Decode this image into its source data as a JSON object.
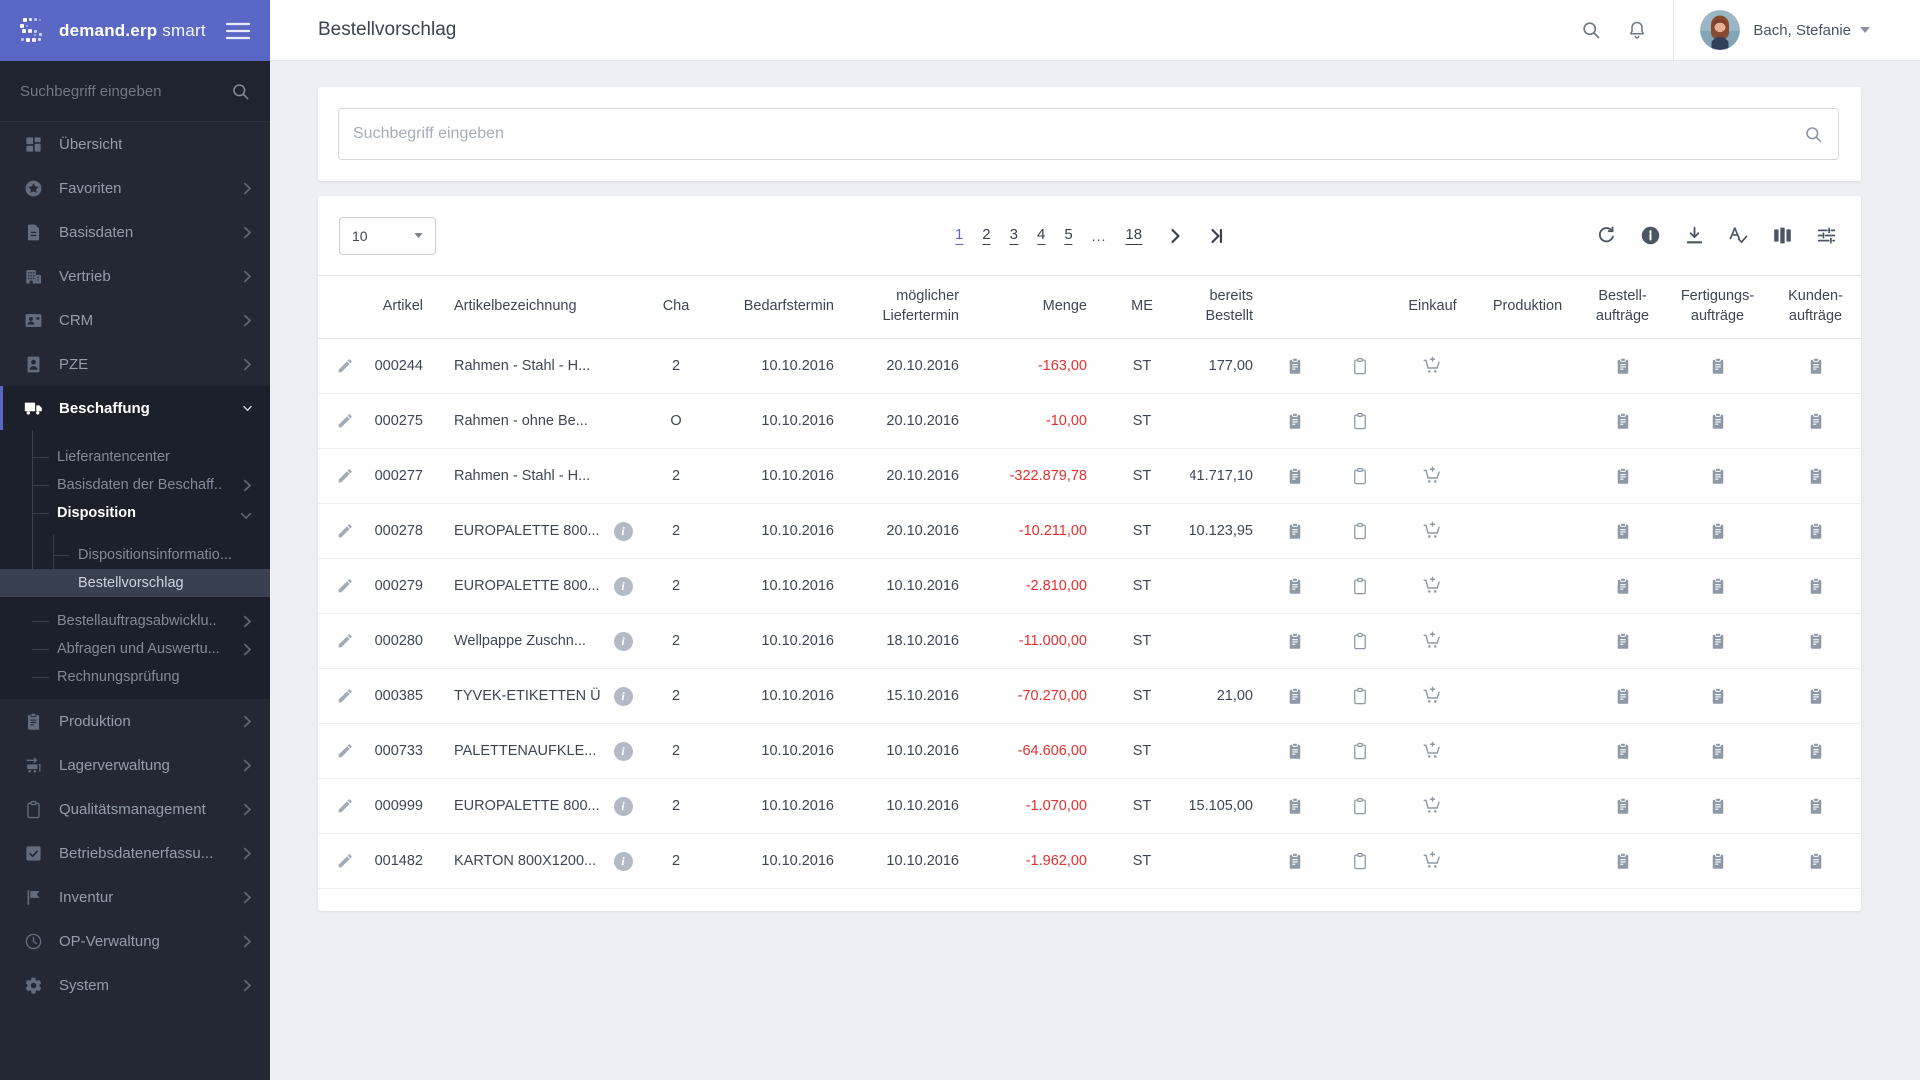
{
  "colors": {
    "brand_purple": "#5a67c4",
    "sidebar_bg": "#232834",
    "sidebar_dark": "#1b202a",
    "danger_red": "#e62e2e",
    "page_bg": "#edeff4",
    "selected_subitem_bg": "#394050"
  },
  "brand": {
    "name_bold": "demand.erp",
    "name_light": "smart"
  },
  "topbar": {
    "title": "Bestellvorschlag",
    "user_name": "Bach, Stefanie"
  },
  "sidebar": {
    "search_placeholder": "Suchbegriff eingeben",
    "items": [
      {
        "label": "Übersicht",
        "icon": "dashboard"
      },
      {
        "label": "Favoriten",
        "icon": "star",
        "chevron": "right"
      },
      {
        "label": "Basisdaten",
        "icon": "document",
        "chevron": "right"
      },
      {
        "label": "Vertrieb",
        "icon": "building",
        "chevron": "right"
      },
      {
        "label": "CRM",
        "icon": "contact-card",
        "chevron": "right"
      },
      {
        "label": "PZE",
        "icon": "person-badge",
        "chevron": "right"
      },
      {
        "label": "Beschaffung",
        "icon": "truck",
        "chevron": "down",
        "active": true,
        "children": [
          {
            "label": "Lieferantencenter"
          },
          {
            "label": "Basisdaten der Beschaff..",
            "chevron": "right"
          },
          {
            "label": "Disposition",
            "bold": true,
            "chevron": "down",
            "children": [
              {
                "label": "Dispositionsinformatio..."
              },
              {
                "label": "Bestellvorschlag",
                "selected": true
              }
            ]
          },
          {
            "label": "Bestellauftragsabwicklu..",
            "chevron": "right"
          },
          {
            "label": "Abfragen und Auswertu...",
            "chevron": "right"
          },
          {
            "label": "Rechnungsprüfung"
          }
        ]
      },
      {
        "label": "Produktion",
        "icon": "clipboard-filled",
        "chevron": "right"
      },
      {
        "label": "Lagerverwaltung",
        "icon": "forklift",
        "chevron": "right"
      },
      {
        "label": "Qualitätsmanagement",
        "icon": "clipboard-outline",
        "chevron": "right"
      },
      {
        "label": "Betriebsdatenerfassu...",
        "icon": "check-square",
        "chevron": "right"
      },
      {
        "label": "Inventur",
        "icon": "flag",
        "chevron": "right"
      },
      {
        "label": "OP-Verwaltung",
        "icon": "clock",
        "chevron": "right"
      },
      {
        "label": "System",
        "icon": "gear",
        "chevron": "right"
      }
    ]
  },
  "search": {
    "placeholder": "Suchbegriff eingeben"
  },
  "controls": {
    "per_page": "10",
    "pages": [
      "1",
      "2",
      "3",
      "4",
      "5"
    ],
    "ellipsis": "...",
    "last_page": "18",
    "active_page": "1",
    "toolbar_icons": [
      "refresh",
      "info",
      "download",
      "spellcheck",
      "columns",
      "tune"
    ]
  },
  "table": {
    "columns": [
      {
        "key": "edit",
        "label": "",
        "align": "ac"
      },
      {
        "key": "artikel",
        "label": "Artikel",
        "align": "ar"
      },
      {
        "key": "bezeichnung",
        "label": "Artikelbezeichnung",
        "align": "al pad-name"
      },
      {
        "key": "info",
        "label": "",
        "align": "ac"
      },
      {
        "key": "cha",
        "label": "Cha",
        "align": "ac"
      },
      {
        "key": "bedarfstermin",
        "label": "Bedarfstermin",
        "align": "ar"
      },
      {
        "key": "liefertermin",
        "label": "möglicher\nLiefertermin",
        "align": "ar"
      },
      {
        "key": "menge",
        "label": "Menge",
        "align": "ar"
      },
      {
        "key": "me",
        "label": "ME",
        "align": "ac"
      },
      {
        "key": "bereits_bestellt",
        "label": "bereits\nBestellt",
        "align": "ar"
      },
      {
        "key": "doc",
        "label": "",
        "align": "ac"
      },
      {
        "key": "copy",
        "label": "",
        "align": "ac"
      },
      {
        "key": "einkauf",
        "label": "Einkauf",
        "align": "ac"
      },
      {
        "key": "produktion",
        "label": "Produktion",
        "align": "ac"
      },
      {
        "key": "bestellauftraege",
        "label": "Bestell-\naufträge",
        "align": "ac"
      },
      {
        "key": "fertigungsauftraege",
        "label": "Fertigungs-\naufträge",
        "align": "ac"
      },
      {
        "key": "kundenauftraege",
        "label": "Kunden-\naufträge",
        "align": "ac"
      }
    ],
    "rows": [
      {
        "artikel": "000244",
        "bezeichnung": "Rahmen - Stahl - H...",
        "has_info": false,
        "cha": "2",
        "bedarfstermin": "10.10.2016",
        "liefertermin": "20.10.2016",
        "menge": "-163,00",
        "me": "ST",
        "bereits_bestellt": "177,00",
        "icons": {
          "doc": true,
          "copy": true,
          "einkauf": true,
          "produktion": false,
          "bestellauftraege": true,
          "fertigungsauftraege": true,
          "kundenauftraege": true
        }
      },
      {
        "artikel": "000275",
        "bezeichnung": "Rahmen - ohne Be...",
        "has_info": false,
        "cha": "O",
        "bedarfstermin": "10.10.2016",
        "liefertermin": "20.10.2016",
        "menge": "-10,00",
        "me": "ST",
        "bereits_bestellt": "",
        "icons": {
          "doc": true,
          "copy": true,
          "einkauf": false,
          "produktion": false,
          "bestellauftraege": true,
          "fertigungsauftraege": true,
          "kundenauftraege": true
        }
      },
      {
        "artikel": "000277",
        "bezeichnung": "Rahmen - Stahl - H...",
        "has_info": false,
        "cha": "2",
        "bedarfstermin": "10.10.2016",
        "liefertermin": "20.10.2016",
        "menge": "-322.879,78",
        "me": "ST",
        "bereits_bestellt": "41.717,10",
        "icons": {
          "doc": true,
          "copy": true,
          "einkauf": true,
          "produktion": false,
          "bestellauftraege": true,
          "fertigungsauftraege": true,
          "kundenauftraege": true
        }
      },
      {
        "artikel": "000278",
        "bezeichnung": "EUROPALETTE 800...",
        "has_info": true,
        "cha": "2",
        "bedarfstermin": "10.10.2016",
        "liefertermin": "20.10.2016",
        "menge": "-10.211,00",
        "me": "ST",
        "bereits_bestellt": "10.123,95",
        "icons": {
          "doc": true,
          "copy": true,
          "einkauf": true,
          "produktion": false,
          "bestellauftraege": true,
          "fertigungsauftraege": true,
          "kundenauftraege": true
        }
      },
      {
        "artikel": "000279",
        "bezeichnung": "EUROPALETTE 800...",
        "has_info": true,
        "cha": "2",
        "bedarfstermin": "10.10.2016",
        "liefertermin": "10.10.2016",
        "menge": "-2.810,00",
        "me": "ST",
        "bereits_bestellt": "",
        "icons": {
          "doc": true,
          "copy": true,
          "einkauf": true,
          "produktion": false,
          "bestellauftraege": true,
          "fertigungsauftraege": true,
          "kundenauftraege": true
        }
      },
      {
        "artikel": "000280",
        "bezeichnung": "Wellpappe Zuschn...",
        "has_info": true,
        "cha": "2",
        "bedarfstermin": "10.10.2016",
        "liefertermin": "18.10.2016",
        "menge": "-11.000,00",
        "me": "ST",
        "bereits_bestellt": "",
        "icons": {
          "doc": true,
          "copy": true,
          "einkauf": true,
          "produktion": false,
          "bestellauftraege": true,
          "fertigungsauftraege": true,
          "kundenauftraege": true
        }
      },
      {
        "artikel": "000385",
        "bezeichnung": "TYVEK-ETIKETTEN Ü",
        "has_info": true,
        "cha": "2",
        "bedarfstermin": "10.10.2016",
        "liefertermin": "15.10.2016",
        "menge": "-70.270,00",
        "me": "ST",
        "bereits_bestellt": "21,00",
        "icons": {
          "doc": true,
          "copy": true,
          "einkauf": true,
          "produktion": false,
          "bestellauftraege": true,
          "fertigungsauftraege": true,
          "kundenauftraege": true
        }
      },
      {
        "artikel": "000733",
        "bezeichnung": "PALETTENAUFKLE...",
        "has_info": true,
        "cha": "2",
        "bedarfstermin": "10.10.2016",
        "liefertermin": "10.10.2016",
        "menge": "-64.606,00",
        "me": "ST",
        "bereits_bestellt": "",
        "icons": {
          "doc": true,
          "copy": true,
          "einkauf": true,
          "produktion": false,
          "bestellauftraege": true,
          "fertigungsauftraege": true,
          "kundenauftraege": true
        }
      },
      {
        "artikel": "000999",
        "bezeichnung": "EUROPALETTE 800...",
        "has_info": true,
        "cha": "2",
        "bedarfstermin": "10.10.2016",
        "liefertermin": "10.10.2016",
        "menge": "-1.070,00",
        "me": "ST",
        "bereits_bestellt": "15.105,00",
        "icons": {
          "doc": true,
          "copy": true,
          "einkauf": true,
          "produktion": false,
          "bestellauftraege": true,
          "fertigungsauftraege": true,
          "kundenauftraege": true
        }
      },
      {
        "artikel": "001482",
        "bezeichnung": "KARTON 800X1200...",
        "has_info": true,
        "cha": "2",
        "bedarfstermin": "10.10.2016",
        "liefertermin": "10.10.2016",
        "menge": "-1.962,00",
        "me": "ST",
        "bereits_bestellt": "",
        "icons": {
          "doc": true,
          "copy": true,
          "einkauf": true,
          "produktion": false,
          "bestellauftraege": true,
          "fertigungsauftraege": true,
          "kundenauftraege": true
        }
      }
    ]
  }
}
